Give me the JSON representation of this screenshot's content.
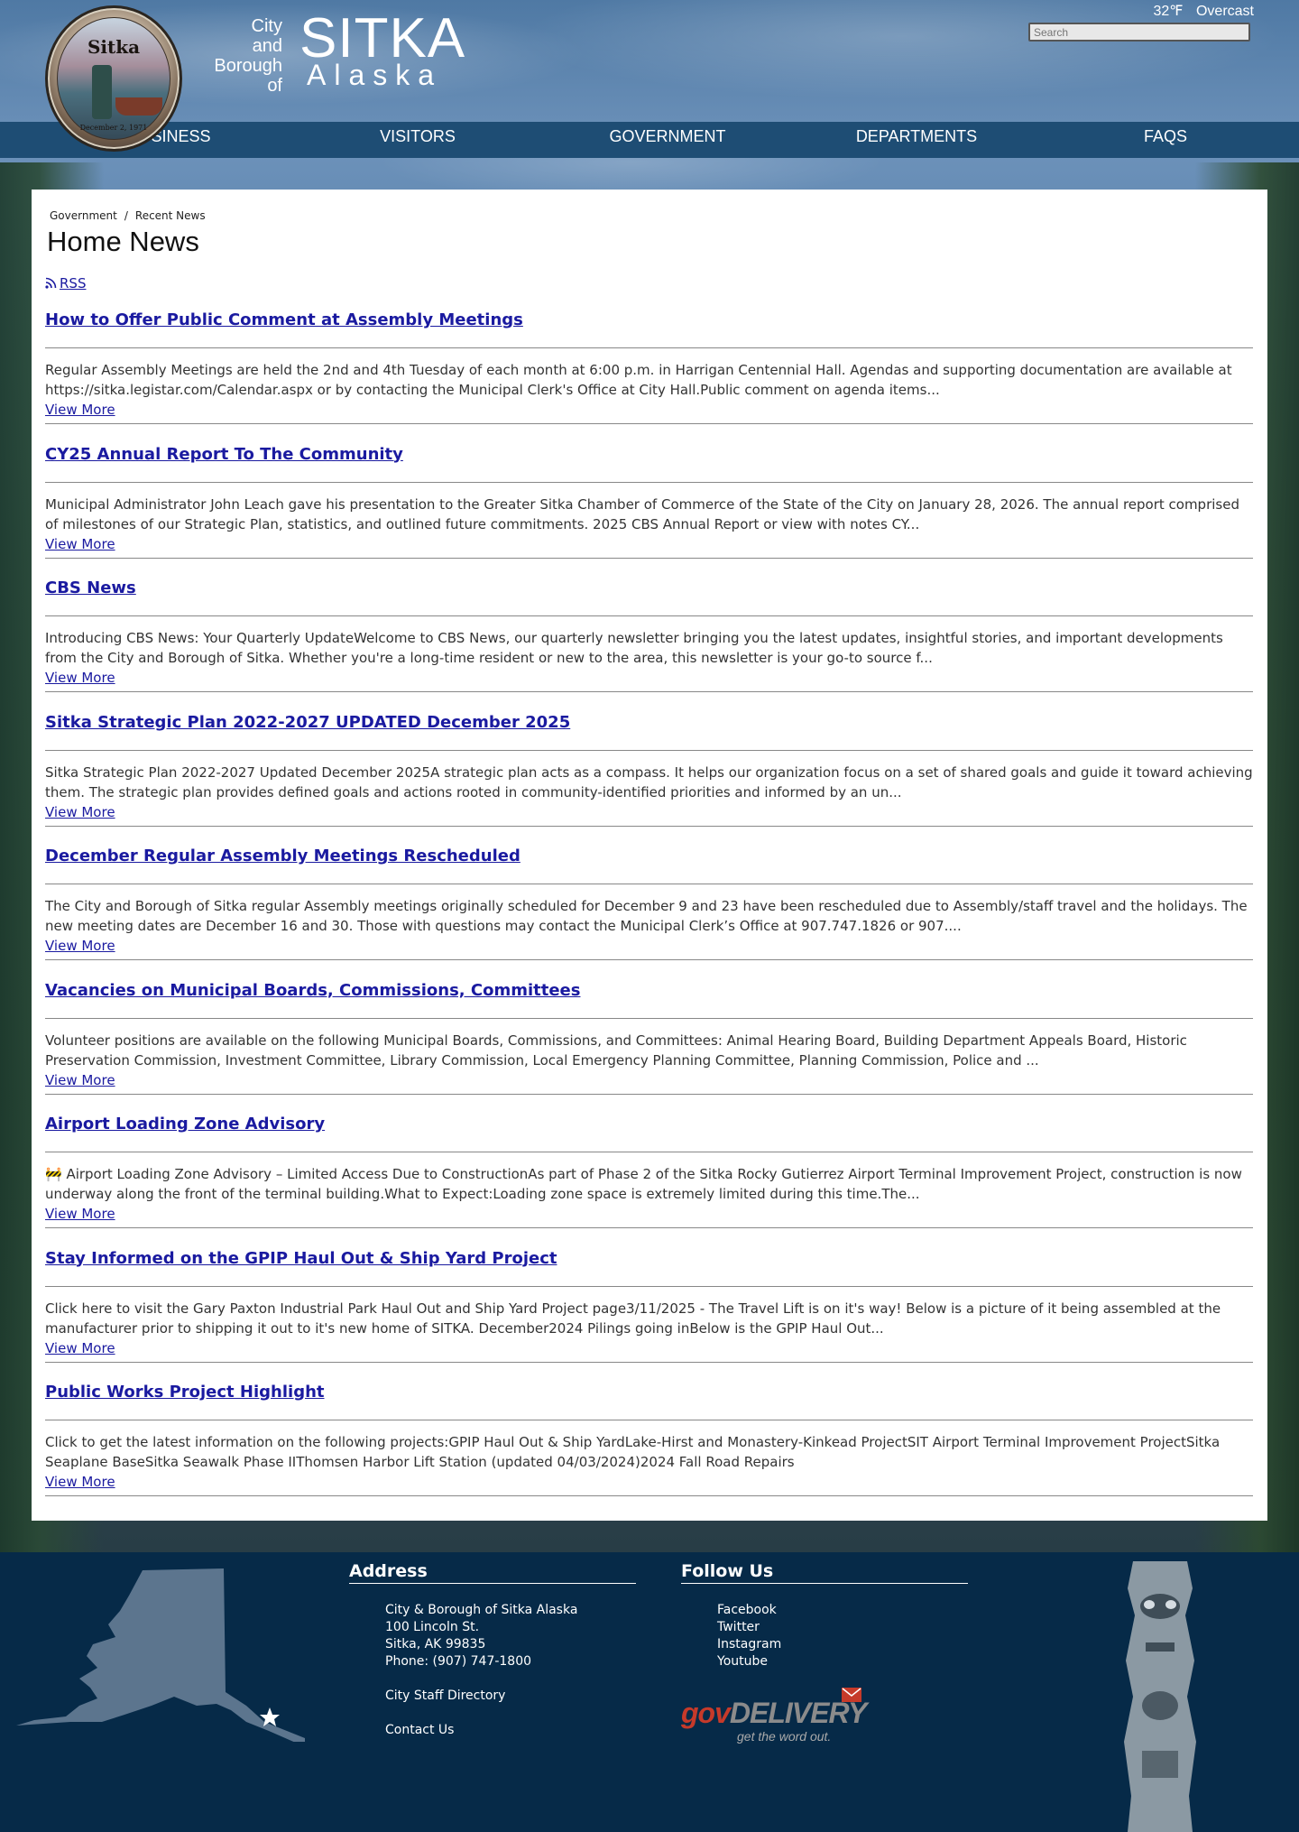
{
  "header": {
    "brand_small_lines": [
      "City",
      "and",
      "Borough",
      "of"
    ],
    "brand_big": "SITKA",
    "brand_sub": "Alaska",
    "seal_text": "Sitka",
    "seal_bottom": "December 2, 1971",
    "weather_temp": "32℉",
    "weather_desc": "Overcast",
    "search_placeholder": "Search"
  },
  "nav": [
    "BUSINESS",
    "VISITORS",
    "GOVERNMENT",
    "DEPARTMENTS",
    "FAQS"
  ],
  "breadcrumb": [
    "Government",
    "Recent News"
  ],
  "page_title": "Home News",
  "rss_label": "RSS",
  "view_more_label": "View More",
  "news": [
    {
      "title": "How to Offer Public Comment at Assembly Meetings",
      "summary": "Regular Assembly Meetings are held the 2nd and 4th Tuesday of each month at 6:00 p.m. in Harrigan Centennial Hall. Agendas and supporting documentation are available at https://sitka.legistar.com/Calendar.aspx or by contacting the Municipal Clerk's Office at City Hall.Public comment on agenda items..."
    },
    {
      "title": "CY25 Annual Report To The Community",
      "summary": "Municipal Administrator John Leach gave his presentation to the Greater Sitka Chamber of Commerce of the State of the City on January 28, 2026. The annual report comprised of milestones of our Strategic Plan, statistics, and outlined future commitments. 2025 CBS Annual Report or view with notes  CY..."
    },
    {
      "title": "CBS News",
      "summary": "Introducing CBS News: Your Quarterly UpdateWelcome to CBS News, our quarterly newsletter bringing you the latest updates, insightful stories, and important developments from the City and Borough of Sitka. Whether you're a long-time resident or new to the area, this newsletter is your go-to source f..."
    },
    {
      "title": "Sitka Strategic Plan 2022-2027 UPDATED December 2025",
      "summary": " Sitka Strategic Plan 2022-2027 Updated December 2025A strategic plan acts as a compass. It helps our organization focus on a set of shared goals and guide it toward achieving them. The strategic plan provides defined goals and actions rooted in community-identified priorities and informed by an un..."
    },
    {
      "title": "December Regular Assembly Meetings Rescheduled",
      "summary": "The City and Borough of Sitka regular Assembly meetings originally scheduled for December 9 and 23 have been rescheduled due to Assembly/staff travel and the holidays. The new meeting dates are December 16 and 30. Those with questions may contact the Municipal Clerk’s Office at 907.747.1826 or 907...."
    },
    {
      "title": "Vacancies on Municipal Boards, Commissions, Committees",
      "summary": "Volunteer positions are available on the following Municipal Boards, Commissions, and Committees: Animal Hearing Board, Building Department Appeals Board, Historic Preservation Commission, Investment Committee, Library Commission, Local Emergency Planning Committee, Planning Commission, Police and ..."
    },
    {
      "title": "Airport Loading Zone Advisory",
      "summary": "🚧 Airport Loading Zone Advisory – Limited Access Due to ConstructionAs part of Phase 2 of the Sitka Rocky Gutierrez Airport Terminal Improvement Project, construction is now underway along the front of the terminal building.What to Expect:Loading zone space is extremely limited during this time.The..."
    },
    {
      "title": "Stay Informed on the GPIP Haul Out & Ship Yard Project",
      "summary": "Click here to visit the Gary Paxton Industrial Park Haul Out and Ship Yard Project page3/11/2025 - The Travel Lift is on it's way! Below is a picture of it being assembled at the manufacturer prior to shipping it out to it's new home of SITKA. December2024 Pilings going inBelow is the GPIP Haul Out..."
    },
    {
      "title": "Public Works Project Highlight",
      "summary": "Click to get the latest information on the following projects:GPIP Haul Out & Ship YardLake-Hirst and Monastery-Kinkead ProjectSIT Airport Terminal Improvement ProjectSitka Seaplane BaseSitka Seawalk Phase IIThomsen Harbor Lift Station (updated 04/03/2024)2024 Fall Road Repairs"
    }
  ],
  "footer": {
    "address_heading": "Address",
    "address_lines": [
      "City & Borough of Sitka Alaska",
      "100 Lincoln St.",
      "Sitka, AK 99835",
      "Phone: (907) 747-1800"
    ],
    "staff_directory": "City Staff Directory",
    "contact_us": "Contact Us",
    "follow_heading": "Follow Us",
    "social": [
      "Facebook",
      "Twitter",
      "Instagram",
      "Youtube"
    ],
    "govdelivery_gov": "gov",
    "govdelivery_delivery": "DELIVERY",
    "govdelivery_tagline": "get the word out."
  }
}
